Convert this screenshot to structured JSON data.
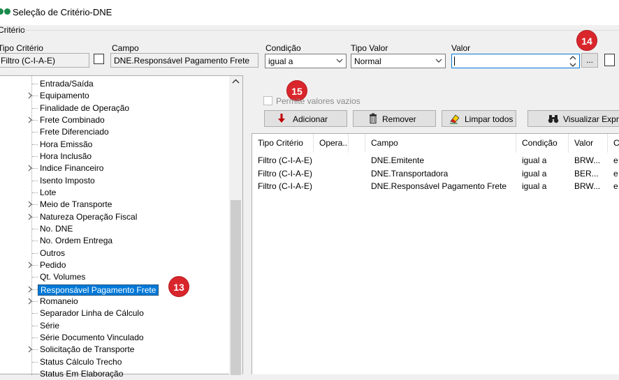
{
  "window": {
    "title": "Seleção de Critério-DNE"
  },
  "group": {
    "label": "Critério"
  },
  "fields": {
    "tipo_criterio_label": "Tipo Critério",
    "tipo_criterio_value": "Filtro (C-I-A-E)",
    "campo_label": "Campo",
    "campo_value": "DNE.Responsável Pagamento Frete",
    "condicao_label": "Condição",
    "condicao_value": "igual a",
    "tipo_valor_label": "Tipo Valor",
    "tipo_valor_value": "Normal",
    "valor_label": "Valor",
    "valor_value": "",
    "ellipsis_label": "..."
  },
  "badges": {
    "b13": "13",
    "b14": "14",
    "b15": "15"
  },
  "options": {
    "permite_vazios_label": "Permite valores vazios"
  },
  "buttons": {
    "adicionar": "Adicionar",
    "remover": "Remover",
    "limpar": "Limpar todos",
    "visualizar": "Visualizar Expre"
  },
  "tree": {
    "items": [
      {
        "label": "Entrada/Saída",
        "expandable": false
      },
      {
        "label": "Equipamento",
        "expandable": true
      },
      {
        "label": "Finalidade de Operação",
        "expandable": false
      },
      {
        "label": "Frete Combinado",
        "expandable": true
      },
      {
        "label": "Frete Diferenciado",
        "expandable": false
      },
      {
        "label": "Hora Emissão",
        "expandable": false
      },
      {
        "label": "Hora Inclusão",
        "expandable": false
      },
      {
        "label": "Indice Financeiro",
        "expandable": true
      },
      {
        "label": "Isento Imposto",
        "expandable": false
      },
      {
        "label": "Lote",
        "expandable": false
      },
      {
        "label": "Meio de Transporte",
        "expandable": true
      },
      {
        "label": "Natureza Operação Fiscal",
        "expandable": true
      },
      {
        "label": "No. DNE",
        "expandable": false
      },
      {
        "label": "No. Ordem Entrega",
        "expandable": false
      },
      {
        "label": "Outros",
        "expandable": false
      },
      {
        "label": "Pedido",
        "expandable": true
      },
      {
        "label": "Qt. Volumes",
        "expandable": false
      },
      {
        "label": "Responsável Pagamento Frete",
        "expandable": true,
        "selected": true
      },
      {
        "label": "Romaneio",
        "expandable": true
      },
      {
        "label": "Separador Linha de Cálculo",
        "expandable": false
      },
      {
        "label": "Série",
        "expandable": false
      },
      {
        "label": "Série Documento Vinculado",
        "expandable": false
      },
      {
        "label": "Solicitação de Transporte",
        "expandable": true
      },
      {
        "label": "Status Cálculo Trecho",
        "expandable": false
      },
      {
        "label": "Status Em Elaboração",
        "expandable": false
      }
    ]
  },
  "grid": {
    "columns": [
      "Tipo Critério",
      "Opera...",
      "",
      "Campo",
      "Condição",
      "Valor",
      "C"
    ],
    "rows": [
      [
        "Filtro (C-I-A-E)",
        "",
        "",
        "DNE.Emitente",
        "igual a",
        "BRW...",
        "e"
      ],
      [
        "Filtro (C-I-A-E)",
        "",
        "",
        "DNE.Transportadora",
        "igual a",
        "BER...",
        "e"
      ],
      [
        "Filtro (C-I-A-E)",
        "",
        "",
        "DNE.Responsável Pagamento Frete",
        "igual a",
        "BRW...",
        "e"
      ]
    ]
  },
  "colors": {
    "accent": "#0078d7",
    "badge": "#d9262c",
    "icon_green": "#1a8a4a"
  }
}
